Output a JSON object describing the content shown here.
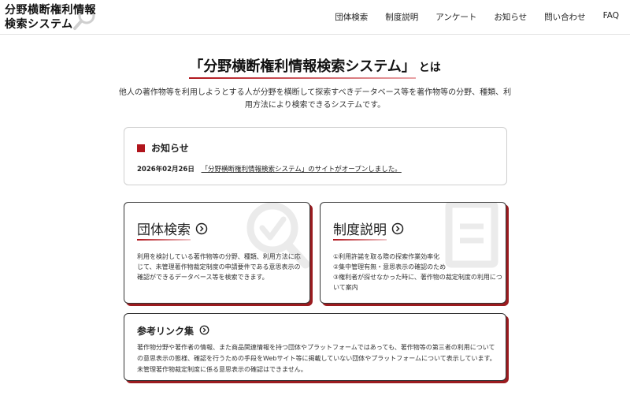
{
  "header": {
    "logo_line1": "分野横断権利情報",
    "logo_line2": "検索システム",
    "nav": [
      "団体検索",
      "制度説明",
      "アンケート",
      "お知らせ",
      "問い合わせ",
      "FAQ"
    ]
  },
  "hero": {
    "title": "「分野横断権利情報検索システム」",
    "title_suffix": "とは",
    "description": "他人の著作物等を利用しようとする人が分野を横断して探索すべきデータベース等を著作物等の分野、種類、利用方法により検索できるシステムです。"
  },
  "news": {
    "heading": "お知らせ",
    "date": "2026年02月26日",
    "link_text": "「分野横断権利情報検索システム」のサイトがオープンしました。"
  },
  "cards": {
    "group_search": {
      "title": "団体検索",
      "text": "利用を検討している著作物等の分野、種類、利用方法に応じて、未管理著作物裁定制度の申請要件である意思表示の確認ができるデータベース等を検索できます。"
    },
    "system_explain": {
      "title": "制度説明",
      "items": [
        "①利用許諾を取る際の探索作業効率化",
        "②集中管理有無・意思表示の確認のため",
        "③権利者が探せなかった時に、著作物の裁定制度の利用について案内"
      ]
    },
    "reference_links": {
      "title": "参考リンク集",
      "text": "著作物分野や著作者の情報、また商品関連情報を持つ団体やプラットフォームではあっても、著作物等の第三者の利用についての意思表示の態様、確認を行うための手段をWebサイト等に掲載していない団体やプラットフォームについて表示しています。未管理著作物裁定制度に係る意思表示の確認はできません。"
    }
  },
  "colors": {
    "accent": "#b0151c",
    "card_shadow": "#9b1b1f",
    "watermark": "#ebebeb"
  }
}
